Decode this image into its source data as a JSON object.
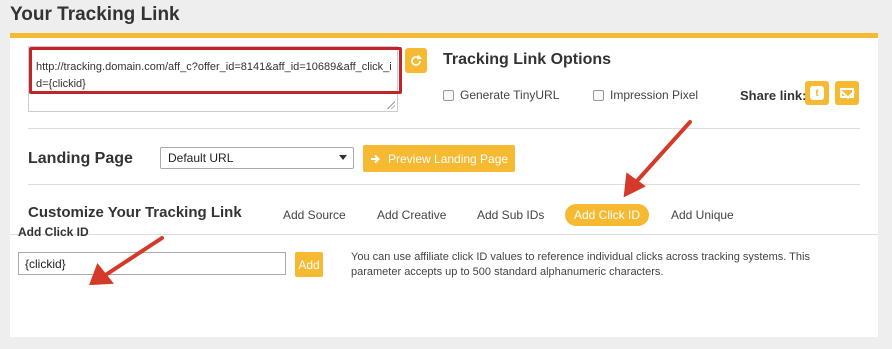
{
  "page_title": "Your Tracking Link",
  "tracking_link": {
    "url": "http://tracking.domain.com/aff_c?offer_id=8141&aff_id=10689&aff_click_id={clickid}",
    "refresh_icon": "refresh-icon"
  },
  "options": {
    "title": "Tracking Link Options",
    "generate_tinyurl_label": "Generate TinyURL",
    "impression_pixel_label": "Impression Pixel",
    "share_label": "Share link:",
    "twitter_icon": "twitter-icon",
    "email_icon": "email-icon"
  },
  "landing_page": {
    "label": "Landing Page",
    "selected": "Default URL",
    "preview_label": "Preview Landing Page"
  },
  "customize": {
    "label": "Customize Your Tracking Link",
    "tabs": [
      "Add Source",
      "Add Creative",
      "Add Sub IDs",
      "Add Click ID",
      "Add Unique"
    ],
    "active_tab": "Add Click ID"
  },
  "click_id": {
    "label": "Add Click ID",
    "value": "{clickid}",
    "add_label": "Add",
    "description": "You can use affiliate click ID values to reference individual clicks across tracking systems. This parameter accepts up to 500 standard alphanumeric characters."
  },
  "colors": {
    "accent": "#f5b932",
    "highlight": "#c0252a",
    "background": "#eeeeee"
  }
}
